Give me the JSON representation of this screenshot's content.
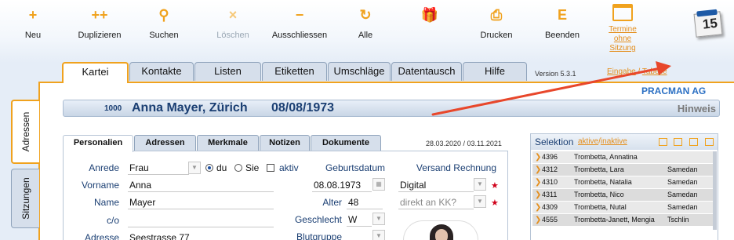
{
  "toolbar": {
    "buttons": [
      {
        "label": "Neu",
        "icon": "+"
      },
      {
        "label": "Duplizieren",
        "icon": "++"
      },
      {
        "label": "Suchen",
        "icon": "⚲"
      },
      {
        "label": "Löschen",
        "icon": "×"
      },
      {
        "label": "Ausschliessen",
        "icon": "−"
      },
      {
        "label": "Alle",
        "icon": "↻"
      },
      {
        "label": "Drucken",
        "icon": "⎙"
      },
      {
        "label": "Beenden",
        "icon": "E"
      }
    ],
    "termine_label": "Termine ohne Sitzung",
    "calendar_day": "15"
  },
  "tabs": [
    "Kartei",
    "Kontakte",
    "Listen",
    "Etiketten",
    "Umschläge",
    "Datentausch",
    "Hilfe"
  ],
  "version": "Version  5.3.1",
  "eingabe": "Eingabe",
  "tabelle": "Tabelle",
  "side_tabs": [
    "Adressen",
    "Sitzungen"
  ],
  "company": "PRACMAN AG",
  "record": {
    "number": "1000",
    "name": "Anna Mayer, Zürich",
    "dob": "08/08/1973",
    "hinweis": "Hinweis"
  },
  "subtabs": [
    "Personalien",
    "Adressen",
    "Merkmale",
    "Notizen",
    "Dokumente"
  ],
  "dates": "28.03.2020  /  03.11.2021",
  "form": {
    "anrede_label": "Anrede",
    "anrede": "Frau",
    "du": "du",
    "sie": "Sie",
    "aktiv": "aktiv",
    "vorname_label": "Vorname",
    "vorname": "Anna",
    "name_label": "Name",
    "name": "Mayer",
    "co_label": "c/o",
    "co": "",
    "adresse_label": "Adresse",
    "adresse": "Seestrasse 77",
    "geburtsdatum_label": "Geburtsdatum",
    "geburtsdatum": "08.08.1973",
    "alter_label": "Alter",
    "alter": "48",
    "geschlecht_label": "Geschlecht",
    "geschlecht": "W",
    "blutgruppe_label": "Blutgruppe",
    "versand_label": "Versand Rechnung",
    "versand": "Digital",
    "kk_placeholder": "direkt an KK?"
  },
  "selektion": {
    "title": "Selektion",
    "aktive": "aktive",
    "inaktive": "inaktive",
    "rows": [
      {
        "id": "4396",
        "name": "Trombetta, Annatina",
        "ort": ""
      },
      {
        "id": "4312",
        "name": "Trombetta, Lara",
        "ort": "Samedan"
      },
      {
        "id": "4310",
        "name": "Trombetta, Natalia",
        "ort": "Samedan"
      },
      {
        "id": "4311",
        "name": "Trombetta, Nico",
        "ort": "Samedan"
      },
      {
        "id": "4309",
        "name": "Trombetta, Nutal",
        "ort": "Samedan"
      },
      {
        "id": "4555",
        "name": "Trombetta-Janett, Mengia",
        "ort": "Tschlin"
      }
    ]
  },
  "colors": {
    "accent": "#f0a21e",
    "title": "#1b3f73",
    "link": "#e48e1c",
    "company": "#2a6fc3",
    "arrow": "#e8472b"
  }
}
